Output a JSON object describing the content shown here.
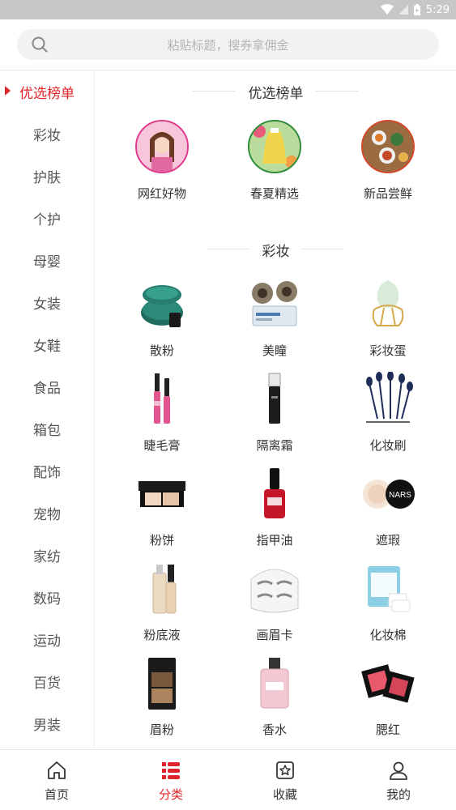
{
  "status_bar": {
    "time": "5:29"
  },
  "search": {
    "placeholder": "粘贴标题，搜券拿佣金"
  },
  "sidebar": {
    "items": [
      {
        "label": "优选榜单",
        "active": true
      },
      {
        "label": "彩妆"
      },
      {
        "label": "护肤"
      },
      {
        "label": "个护"
      },
      {
        "label": "母婴"
      },
      {
        "label": "女装"
      },
      {
        "label": "女鞋"
      },
      {
        "label": "食品"
      },
      {
        "label": "箱包"
      },
      {
        "label": "配饰"
      },
      {
        "label": "宠物"
      },
      {
        "label": "家纺"
      },
      {
        "label": "数码"
      },
      {
        "label": "运动"
      },
      {
        "label": "百货"
      },
      {
        "label": "男装"
      }
    ]
  },
  "sections": [
    {
      "title": "优选榜单",
      "items": [
        {
          "label": "网红好物",
          "icon": "influencer-picks-icon"
        },
        {
          "label": "春夏精选",
          "icon": "spring-summer-picks-icon"
        },
        {
          "label": "新品尝鲜",
          "icon": "new-arrivals-icon"
        }
      ]
    },
    {
      "title": "彩妆",
      "items": [
        {
          "label": "散粉",
          "icon": "loose-powder-icon"
        },
        {
          "label": "美瞳",
          "icon": "color-contacts-icon"
        },
        {
          "label": "彩妆蛋",
          "icon": "makeup-sponge-icon"
        },
        {
          "label": "睫毛膏",
          "icon": "mascara-icon"
        },
        {
          "label": "隔离霜",
          "icon": "primer-icon"
        },
        {
          "label": "化妆刷",
          "icon": "makeup-brush-icon"
        },
        {
          "label": "粉饼",
          "icon": "pressed-powder-icon"
        },
        {
          "label": "指甲油",
          "icon": "nail-polish-icon"
        },
        {
          "label": "遮瑕",
          "icon": "concealer-icon"
        },
        {
          "label": "粉底液",
          "icon": "foundation-icon"
        },
        {
          "label": "画眉卡",
          "icon": "eyebrow-stencil-icon"
        },
        {
          "label": "化妆棉",
          "icon": "cotton-pad-icon"
        },
        {
          "label": "眉粉",
          "icon": "brow-powder-icon"
        },
        {
          "label": "香水",
          "icon": "perfume-icon"
        },
        {
          "label": "腮红",
          "icon": "blush-icon"
        }
      ]
    }
  ],
  "nav_logo": {
    "text": "NARS"
  },
  "bottom_nav": [
    {
      "label": "首页",
      "icon": "home-icon"
    },
    {
      "label": "分类",
      "icon": "category-icon",
      "active": true
    },
    {
      "label": "收藏",
      "icon": "favorites-icon"
    },
    {
      "label": "我的",
      "icon": "profile-icon"
    }
  ],
  "colors": {
    "accent": "#e0262b",
    "status_bar": "#c7c7c7"
  }
}
